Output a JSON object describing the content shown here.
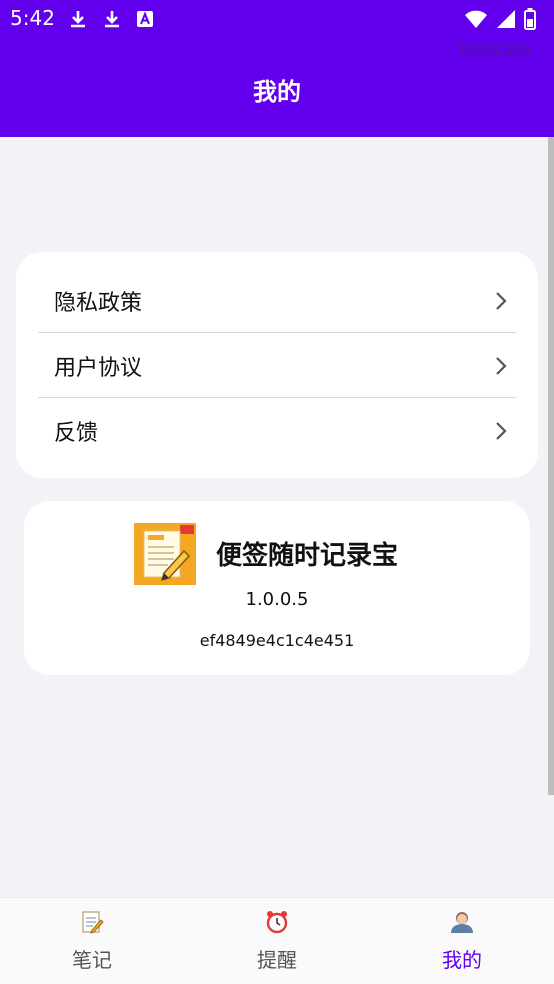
{
  "status_bar": {
    "time": "5:42",
    "icons_left": [
      "download-icon",
      "download-icon",
      "a-box-icon"
    ],
    "icons_right": [
      "wifi-icon",
      "signal-icon",
      "battery-icon"
    ]
  },
  "header": {
    "id_text": "59391389",
    "title": "我的",
    "color": "#6200ee"
  },
  "menu": {
    "items": [
      {
        "label": "隐私政策"
      },
      {
        "label": "用户协议"
      },
      {
        "label": "反馈"
      }
    ]
  },
  "about": {
    "app_name": "便签随时记录宝",
    "version": "1.0.0.5",
    "id": "ef4849e4c1c4e451"
  },
  "tabs": [
    {
      "label": "笔记",
      "icon": "memo-icon"
    },
    {
      "label": "提醒",
      "icon": "alarm-clock-icon"
    },
    {
      "label": "我的",
      "icon": "user-icon",
      "active": true
    }
  ],
  "colors": {
    "accent": "#6200ee",
    "background": "#f2f2f7"
  }
}
